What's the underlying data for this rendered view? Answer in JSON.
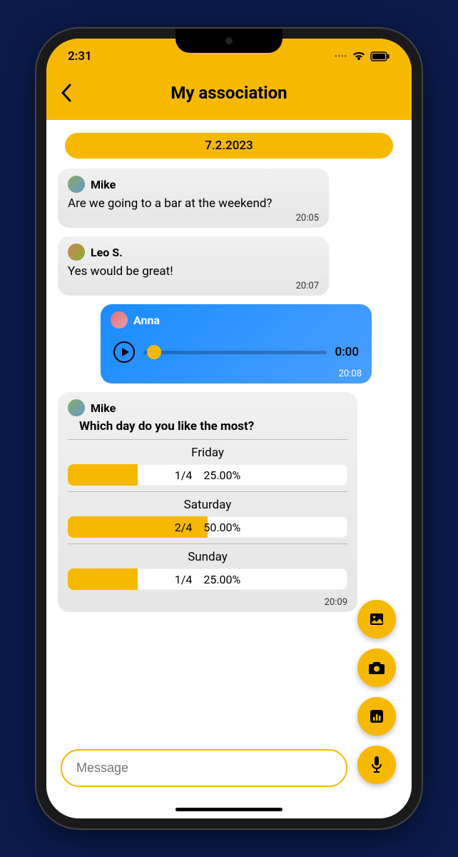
{
  "status": {
    "time": "2:31"
  },
  "header": {
    "title": "My association"
  },
  "date_separator": "7.2.2023",
  "messages": [
    {
      "sender": "Mike",
      "text": "Are we going to a bar at the weekend?",
      "time": "20:05"
    },
    {
      "sender": "Leo S.",
      "text": "Yes would be great!",
      "time": "20:07"
    }
  ],
  "audio_msg": {
    "sender": "Anna",
    "duration": "0:00",
    "time": "20:08"
  },
  "poll": {
    "sender": "Mike",
    "question": "Which day do you like the most?",
    "time": "20:09",
    "options": [
      {
        "label": "Friday",
        "count": "1/4",
        "percent": "25.00%",
        "fill": 25
      },
      {
        "label": "Saturday",
        "count": "2/4",
        "percent": "50.00%",
        "fill": 50
      },
      {
        "label": "Sunday",
        "count": "1/4",
        "percent": "25.00%",
        "fill": 25
      }
    ]
  },
  "input": {
    "placeholder": "Message"
  }
}
